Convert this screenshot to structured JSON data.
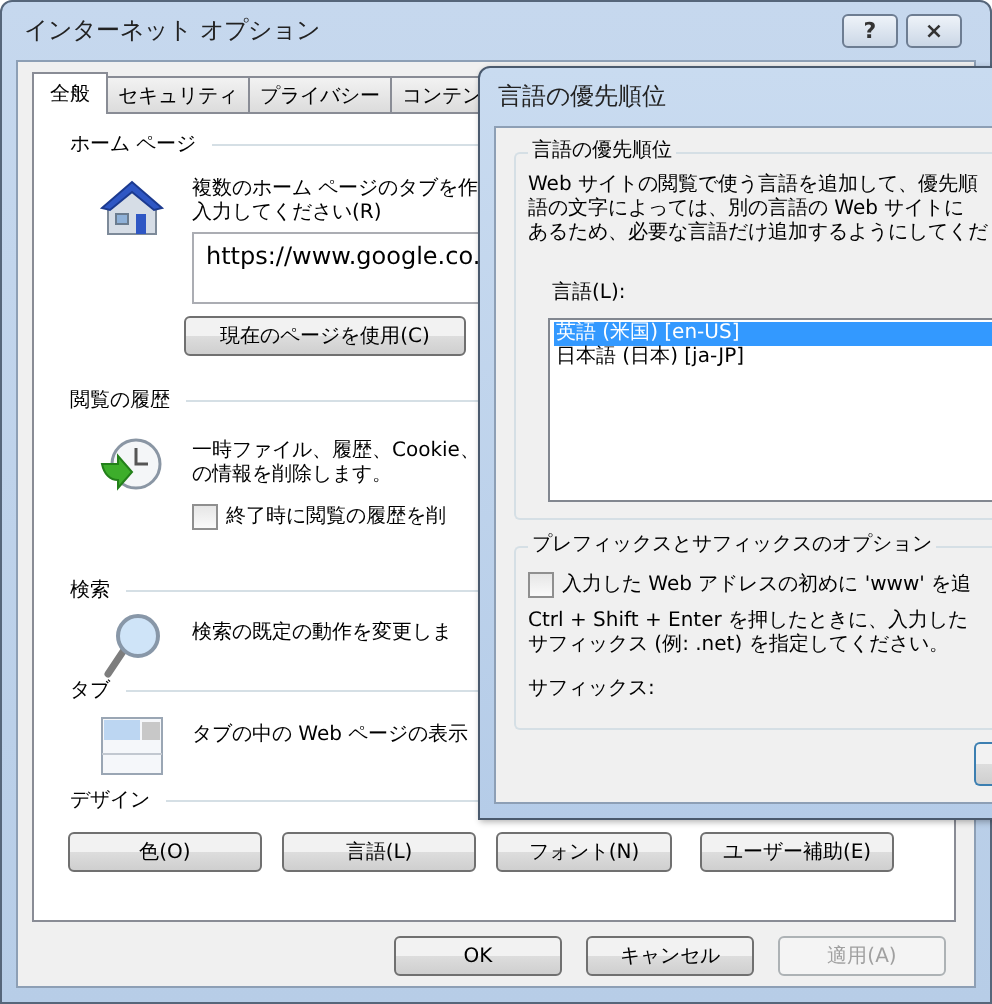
{
  "window": {
    "title": "インターネット オプション",
    "help_button": "?",
    "close_button": "×"
  },
  "tabs": [
    {
      "label": "全般",
      "selected": true
    },
    {
      "label": "セキュリティ",
      "selected": false
    },
    {
      "label": "プライバシー",
      "selected": false
    },
    {
      "label": "コンテン",
      "selected": false
    }
  ],
  "sections": [
    {
      "kind": "home",
      "heading": "ホーム ページ",
      "lines": [
        "複数のホーム ページのタブを作",
        "入力してください(R)"
      ],
      "url": "https://www.google.co.",
      "button": "現在のページを使用(C)"
    },
    {
      "kind": "history",
      "heading": "閲覧の履歴",
      "lines": [
        "一時ファイル、履歴、Cookie、",
        "の情報を削除します。"
      ],
      "checkbox": {
        "label": "終了時に閲覧の履歴を削",
        "checked": false
      }
    },
    {
      "kind": "search",
      "heading": "検索",
      "lines": [
        "検索の既定の動作を変更しま"
      ]
    },
    {
      "kind": "tabs",
      "heading": "タブ",
      "lines": [
        "タブの中の Web ページの表示"
      ]
    }
  ],
  "design": {
    "heading": "デザイン",
    "buttons": [
      "色(O)",
      "言語(L)",
      "フォント(N)",
      "ユーザー補助(E)"
    ]
  },
  "footer_buttons": [
    {
      "label": "OK",
      "disabled": false
    },
    {
      "label": "キャンセル",
      "disabled": false
    },
    {
      "label": "適用(A)",
      "disabled": true
    }
  ],
  "dialog": {
    "title": "言語の優先順位",
    "group": {
      "heading": "言語の優先順位",
      "lines": [
        "Web サイトの閲覧で使う言語を追加して、優先順",
        "語の文字によっては、別の言語の Web サイトに",
        "あるため、必要な言語だけ追加するようにしてくだ"
      ],
      "list_label": "言語(L):",
      "languages": [
        {
          "label": "英語 (米国) [en-US]",
          "selected": true
        },
        {
          "label": "日本語 (日本) [ja-JP]",
          "selected": false
        }
      ]
    },
    "options": {
      "heading": "プレフィックスとサフィックスのオプション",
      "checkbox": {
        "label": "入力した Web アドレスの初めに 'www' を追",
        "checked": false
      },
      "lines": [
        "Ctrl + Shift + Enter を押したときに、入力した",
        "サフィックス (例: .net) を指定してください。"
      ],
      "suffix_label": "サフィックス:"
    }
  }
}
